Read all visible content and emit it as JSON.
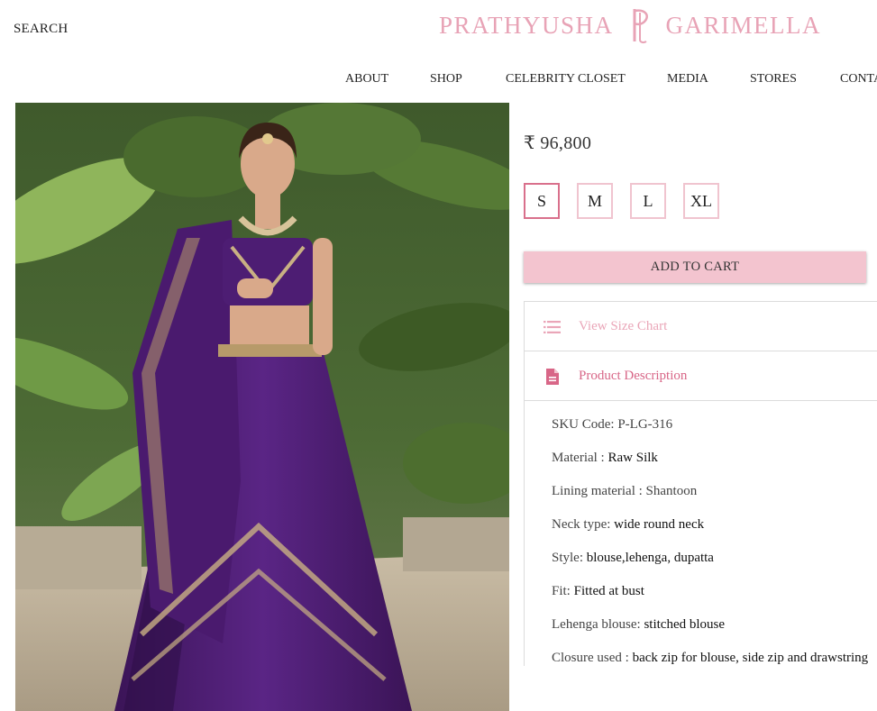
{
  "header": {
    "search_label": "SEARCH",
    "brand_left": "PRATHYUSHA",
    "brand_right": "GARIMELLA",
    "brand_color": "#e8a3b6"
  },
  "nav": {
    "items": [
      "ABOUT",
      "SHOP",
      "CELEBRITY CLOSET",
      "MEDIA",
      "STORES",
      "CONTACT"
    ]
  },
  "product": {
    "image_icon": "product-photo",
    "price": "₹ 96,800",
    "sizes": [
      "S",
      "M",
      "L",
      "XL"
    ],
    "selected_size": "S",
    "add_to_cart": "ADD TO CART",
    "accent_color": "#f3c4cf",
    "size_chart_label": "View Size Chart",
    "size_chart_icon": "list-icon",
    "description_label": "Product Description",
    "description_icon": "document-icon",
    "details": [
      {
        "label": "SKU Code: P-LG-316",
        "value": ""
      },
      {
        "label": "Material : ",
        "value": "Raw Silk"
      },
      {
        "label": "Lining material : Shantoon",
        "value": ""
      },
      {
        "label": "Neck type: ",
        "value": "wide round neck"
      },
      {
        "label": "Style: ",
        "value": "blouse,lehenga, dupatta"
      },
      {
        "label": "Fit: ",
        "value": "Fitted at bust"
      },
      {
        "label": "Lehenga blouse: ",
        "value": "stitched blouse"
      },
      {
        "label": "Closure used : ",
        "value": "back zip for blouse, side zip and drawstring"
      }
    ]
  }
}
